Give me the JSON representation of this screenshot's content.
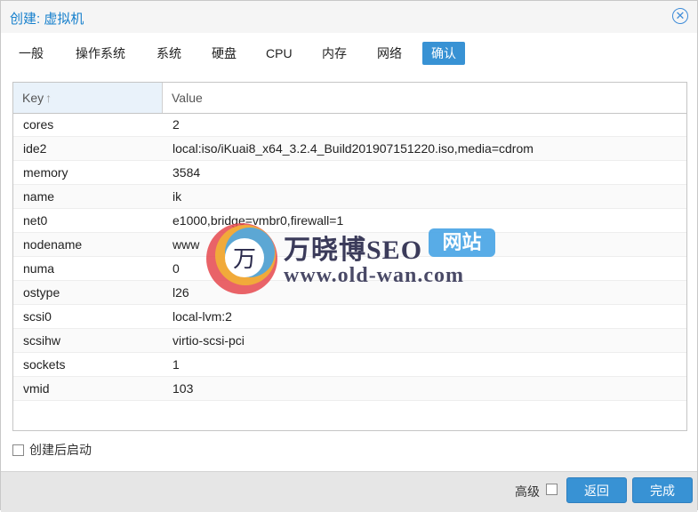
{
  "window": {
    "title": "创建: 虚拟机"
  },
  "tabs": [
    {
      "label": "一般"
    },
    {
      "label": "操作系统"
    },
    {
      "label": "系统"
    },
    {
      "label": "硬盘"
    },
    {
      "label": "CPU"
    },
    {
      "label": "内存"
    },
    {
      "label": "网络"
    },
    {
      "label": "确认"
    }
  ],
  "active_tab": "确认",
  "grid": {
    "columns": {
      "key": "Key",
      "value": "Value"
    },
    "rows": [
      {
        "key": "cores",
        "value": "2"
      },
      {
        "key": "ide2",
        "value": "local:iso/iKuai8_x64_3.2.4_Build201907151220.iso,media=cdrom"
      },
      {
        "key": "memory",
        "value": "3584"
      },
      {
        "key": "name",
        "value": "ik"
      },
      {
        "key": "net0",
        "value": "e1000,bridge=vmbr0,firewall=1"
      },
      {
        "key": "nodename",
        "value": "www"
      },
      {
        "key": "numa",
        "value": "0"
      },
      {
        "key": "ostype",
        "value": "l26"
      },
      {
        "key": "scsi0",
        "value": "local-lvm:2"
      },
      {
        "key": "scsihw",
        "value": "virtio-scsi-pci"
      },
      {
        "key": "sockets",
        "value": "1"
      },
      {
        "key": "vmid",
        "value": "103"
      }
    ]
  },
  "startup_label": "创建后启动",
  "footer": {
    "advanced_label": "高级",
    "back_label": "返回",
    "finish_label": "完成"
  },
  "watermark": {
    "logo_char": "万",
    "name": "万晓博SEO",
    "badge": "网站",
    "url": "www.old-wan.com"
  },
  "colors": {
    "accent": "#3892d4",
    "title": "#157fcc",
    "footer_bg": "#e6e6e6"
  },
  "icons": {
    "close": "close-circle-icon",
    "sort": "sort-ascending-arrow-icon"
  }
}
